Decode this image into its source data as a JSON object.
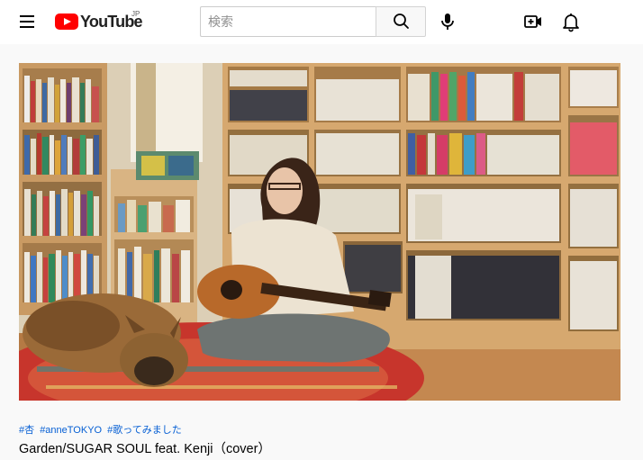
{
  "header": {
    "menu_icon": "hamburger-menu-icon",
    "logo_text": "YouTube",
    "logo_country": "JP",
    "search_placeholder": "検索",
    "search_icon": "search-icon",
    "mic_icon": "microphone-icon",
    "create_icon": "video-plus-icon",
    "notifications_icon": "bell-icon"
  },
  "video": {
    "hashtags": [
      "#杏",
      "#anneTOKYO",
      "#歌ってみました"
    ],
    "title": "Garden/SUGAR SOUL feat. Kenji（cover）"
  },
  "colors": {
    "brand_red": "#ff0000",
    "link_blue": "#065fd4",
    "page_bg": "#f9f9f9"
  }
}
